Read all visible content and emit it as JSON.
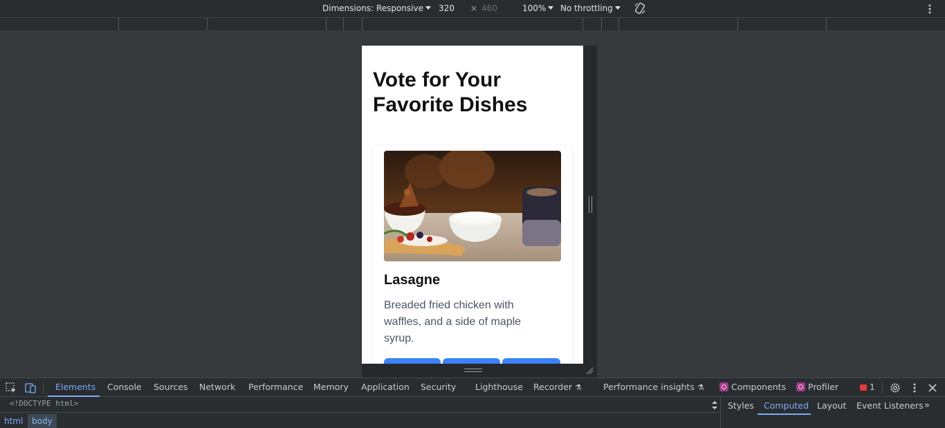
{
  "device_toolbar": {
    "dimensions_label": "Dimensions: Responsive",
    "width": "320",
    "times": "×",
    "height": "460",
    "zoom": "100%",
    "throttling": "No throttling"
  },
  "page": {
    "title": "Vote for Your Favorite Dishes",
    "card": {
      "name": "Lasagne",
      "description": "Breaded fried chicken with waffles, and a side of maple syrup.",
      "button_color": "#3b82f6"
    }
  },
  "devtools": {
    "tabs": [
      "Elements",
      "Console",
      "Sources",
      "Network",
      "Performance",
      "Memory",
      "Application",
      "Security",
      "Lighthouse",
      "Recorder",
      "Performance insights",
      "Components",
      "Profiler"
    ],
    "active_tab": "Elements",
    "error_count": "1",
    "doctype": "<!DOCTYPE html>",
    "breadcrumbs": [
      "html",
      "body"
    ],
    "side_tabs": [
      "Styles",
      "Computed",
      "Layout",
      "Event Listeners"
    ],
    "active_side_tab": "Computed",
    "accent_color": "#7cacf8"
  }
}
